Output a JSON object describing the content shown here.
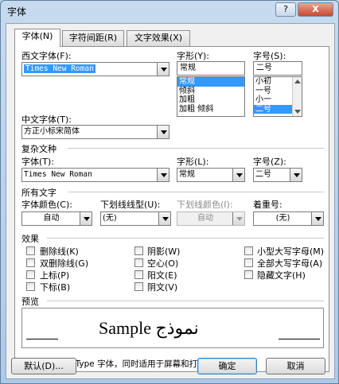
{
  "window": {
    "title": "字体",
    "help_label": "?",
    "close_label": "X"
  },
  "tabs": [
    {
      "label": "字体(N)"
    },
    {
      "label": "字符间距(R)"
    },
    {
      "label": "文字效果(X)"
    }
  ],
  "western_font": {
    "label": "西文字体(F):",
    "value": "Times New Roman"
  },
  "style": {
    "label": "字形(Y):",
    "value": "常规",
    "options": [
      "常规",
      "倾斜",
      "加粗",
      "加粗 倾斜"
    ],
    "selected": "常规"
  },
  "size": {
    "label": "字号(S):",
    "value": "二号",
    "options": [
      "小初",
      "一号",
      "小一",
      "二号"
    ],
    "selected": "二号"
  },
  "asian_font": {
    "label": "中文字体(T):",
    "value": "方正小标宋简体"
  },
  "complex": {
    "section": "复杂文种",
    "font_label": "字体(T):",
    "font_value": "Times New Roman",
    "style_label": "字形(L):",
    "style_value": "常规",
    "size_label": "字号(Z):",
    "size_value": "二号"
  },
  "all_text": {
    "section": "所有文字",
    "color_label": "字体颜色(C):",
    "color_value": "自动",
    "underline_label": "下划线线型(U):",
    "underline_value": "(无)",
    "underline_color_label": "下划线颜色(I):",
    "underline_color_value": "自动",
    "emphasis_label": "着重号:",
    "emphasis_value": "(无)"
  },
  "effects": {
    "section": "效果",
    "col1": [
      "删除线(K)",
      "双删除线(G)",
      "上标(P)",
      "下标(B)"
    ],
    "col2": [
      "阴影(W)",
      "空心(O)",
      "阳文(E)",
      "阴文(V)"
    ],
    "col3": [
      "小型大写字母(M)",
      "全部大写字母(A)",
      "隐藏文字(H)"
    ]
  },
  "preview": {
    "section": "预览",
    "sample": "Sample نموذج"
  },
  "info": "这是一种 TrueType 字体，同时适用于屏幕和打印机。",
  "buttons": {
    "default": "默认(D)...",
    "ok": "确定",
    "cancel": "取消"
  }
}
